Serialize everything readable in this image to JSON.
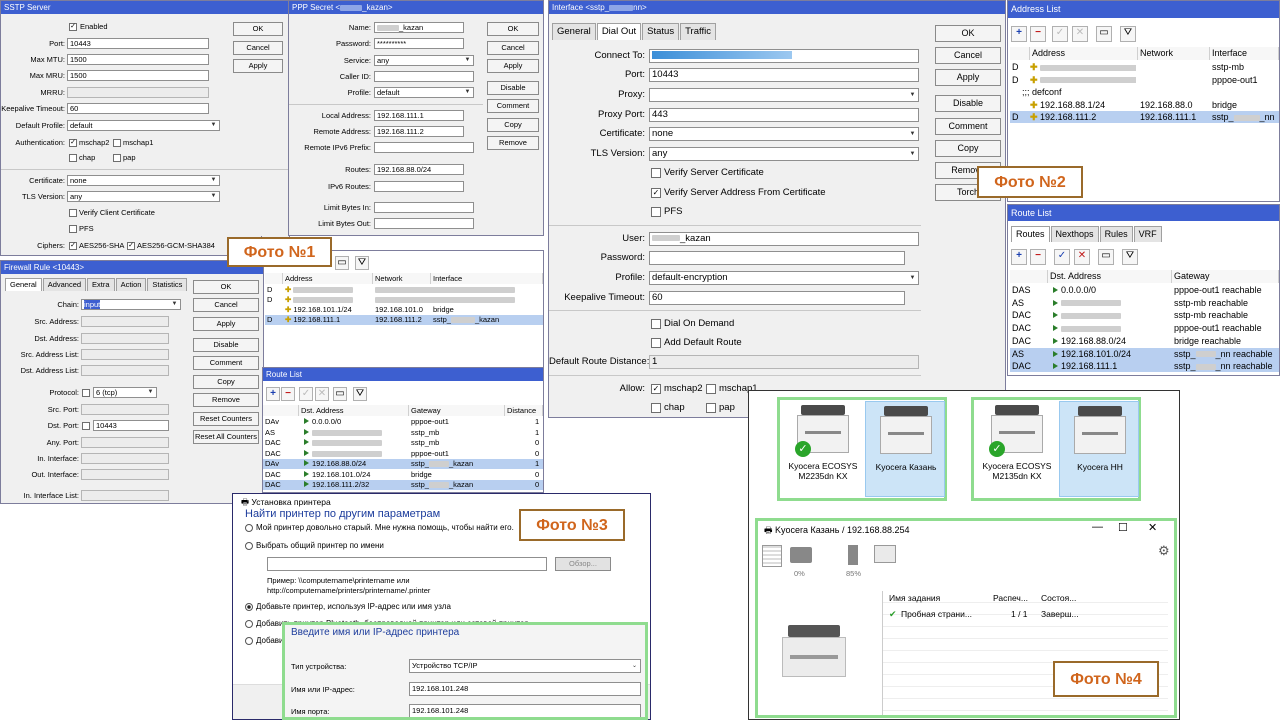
{
  "sstp": {
    "title": "SSTP Server",
    "enabled": "Enabled",
    "port_l": "Port:",
    "port": "10443",
    "mtu_l": "Max MTU:",
    "mtu": "1500",
    "mru_l": "Max MRU:",
    "mru": "1500",
    "mrru_l": "MRRU:",
    "ka_l": "Keepalive Timeout:",
    "ka": "60",
    "dp_l": "Default Profile:",
    "dp": "default",
    "auth_l": "Authentication:",
    "a1": "mschap2",
    "a2": "mschap1",
    "a3": "chap",
    "a4": "pap",
    "cert_l": "Certificate:",
    "cert": "none",
    "tls_l": "TLS Version:",
    "tls": "any",
    "vcc": "Verify Client Certificate",
    "pfs": "PFS",
    "ciph_l": "Ciphers:",
    "c1": "AES256-SHA",
    "c2": "AES256-GCM-SHA384",
    "ok": "OK",
    "cancel": "Cancel",
    "apply": "Apply"
  },
  "ppp": {
    "title": "PPP Secret <",
    "title_end": "_kazan>",
    "name_l": "Name:",
    "name": "_kazan",
    "pw_l": "Password:",
    "pw": "**********",
    "svc_l": "Service:",
    "svc": "any",
    "cid_l": "Caller ID:",
    "prof_l": "Profile:",
    "prof": "default",
    "la_l": "Local Address:",
    "la": "192.168.111.1",
    "ra_l": "Remote Address:",
    "ra": "192.168.111.2",
    "r6_l": "Remote IPv6 Prefix:",
    "rt_l": "Routes:",
    "rt": "192.168.88.0/24",
    "r6r_l": "IPv6 Routes:",
    "lbi_l": "Limit Bytes In:",
    "lbo_l": "Limit Bytes Out:",
    "ok": "OK",
    "cancel": "Cancel",
    "apply": "Apply",
    "disable": "Disable",
    "comment": "Comment",
    "copy": "Copy",
    "remove": "Remove"
  },
  "photo1": "Фото №1",
  "photo2": "Фото №2",
  "photo3": "Фото №3",
  "photo4": "Фото №4",
  "addr1": {
    "h": [
      "Address",
      "Network",
      "Interface"
    ],
    "rows": [
      {
        "f": "D",
        "a": "",
        "n": "",
        "i": ""
      },
      {
        "f": "D",
        "a": "",
        "n": "",
        "i": ""
      },
      {
        "f": "",
        "a": "192.168.101.1/24",
        "n": "192.168.101.0",
        "i": "bridge"
      },
      {
        "f": "D",
        "a": "192.168.111.1",
        "n": "192.168.111.2",
        "i": "sstp_",
        "i2": "_kazan"
      }
    ]
  },
  "fw": {
    "title": "Firewall Rule <10443>",
    "tabs": [
      "General",
      "Advanced",
      "Extra",
      "Action",
      "Statistics"
    ],
    "chain_l": "Chain:",
    "chain": "input",
    "sa_l": "Src. Address:",
    "da_l": "Dst. Address:",
    "sal_l": "Src. Address List:",
    "dal_l": "Dst. Address List:",
    "proto_l": "Protocol:",
    "proto": "6 (tcp)",
    "sp_l": "Src. Port:",
    "dp_l": "Dst. Port:",
    "dp": "10443",
    "ap_l": "Any. Port:",
    "ii_l": "In. Interface:",
    "oi_l": "Out. Interface:",
    "iil_l": "In. Interface List:",
    "b": [
      "OK",
      "Cancel",
      "Apply",
      "Disable",
      "Comment",
      "Copy",
      "Remove",
      "Reset Counters",
      "Reset All Counters"
    ]
  },
  "rl1": {
    "title": "Route List",
    "h": [
      "Dst. Address",
      "Gateway",
      "Distance"
    ],
    "rows": [
      {
        "f": "DAv",
        "d": "0.0.0.0/0",
        "g": "pppoe-out1",
        "x": "1"
      },
      {
        "f": "AS",
        "d": "",
        "g": "sstp_mb",
        "x": "1"
      },
      {
        "f": "DAC",
        "d": "",
        "g": "sstp_mb",
        "x": "0"
      },
      {
        "f": "DAC",
        "d": "",
        "g": "pppoe-out1",
        "x": "0"
      },
      {
        "f": "DAv",
        "d": "192.168.88.0/24",
        "g": "sstp_",
        "g2": "_kazan",
        "x": "1"
      },
      {
        "f": "DAC",
        "d": "192.168.101.0/24",
        "g": "bridge",
        "x": "0"
      },
      {
        "f": "DAC",
        "d": "192.168.111.2/32",
        "g": "sstp_",
        "g2": "_kazan",
        "x": "0"
      }
    ]
  },
  "iface": {
    "title": "Interface <sstp_",
    "title_end": "nn>",
    "tabs": [
      "General",
      "Dial Out",
      "Status",
      "Traffic"
    ],
    "ct_l": "Connect To:",
    "port_l": "Port:",
    "port": "10443",
    "proxy_l": "Proxy:",
    "pp_l": "Proxy Port:",
    "pp": "443",
    "cert_l": "Certificate:",
    "cert": "none",
    "tls_l": "TLS Version:",
    "tls": "any",
    "vsc": "Verify Server Certificate",
    "vsa": "Verify Server Address From Certificate",
    "pfs": "PFS",
    "user_l": "User:",
    "user": "_kazan",
    "pw_l": "Password:",
    "prof_l": "Profile:",
    "prof": "default-encryption",
    "ka_l": "Keepalive Timeout:",
    "ka": "60",
    "dod": "Dial On Demand",
    "adr": "Add Default Route",
    "drd_l": "Default Route Distance:",
    "drd": "1",
    "allow_l": "Allow:",
    "a1": "mschap2",
    "a2": "mschap1",
    "a3": "chap",
    "a4": "pap",
    "b": [
      "OK",
      "Cancel",
      "Apply",
      "Disable",
      "Comment",
      "Copy",
      "Remove",
      "Torch"
    ]
  },
  "addr2": {
    "title": "Address List",
    "h": [
      "Address",
      "Network",
      "Interface"
    ],
    "rows": [
      {
        "f": "D",
        "a": "",
        "n": "",
        "i": "sstp-mb"
      },
      {
        "f": "D",
        "a": "",
        "n": "",
        "i": "pppoe-out1"
      },
      {
        "f": "",
        "a": ";;; defconf",
        "n": "",
        "i": ""
      },
      {
        "f": "",
        "a": "192.168.88.1/24",
        "n": "192.168.88.0",
        "i": "bridge"
      },
      {
        "f": "D",
        "a": "192.168.111.2",
        "n": "192.168.111.1",
        "i": "sstp_",
        "i2": "_nn"
      }
    ]
  },
  "rl2": {
    "title": "Route List",
    "tabs": [
      "Routes",
      "Nexthops",
      "Rules",
      "VRF"
    ],
    "h": [
      "Dst. Address",
      "Gateway"
    ],
    "rows": [
      {
        "f": "DAS",
        "d": "0.0.0.0/0",
        "g": "pppoe-out1 reachable"
      },
      {
        "f": "AS",
        "d": "",
        "g": "sstp-mb reachable"
      },
      {
        "f": "DAC",
        "d": "",
        "g": "sstp-mb reachable"
      },
      {
        "f": "DAC",
        "d": "",
        "g": "pppoe-out1 reachable"
      },
      {
        "f": "DAC",
        "d": "192.168.88.0/24",
        "g": "bridge reachable"
      },
      {
        "f": "AS",
        "d": "192.168.101.0/24",
        "g": "sstp_",
        "g2": "_nn reachable"
      },
      {
        "f": "DAC",
        "d": "192.168.111.1",
        "g": "sstp_",
        "g2": "_nn reachable"
      }
    ]
  },
  "pr": {
    "title": "Установка принтера",
    "head": "Найти принтер по другим параметрам",
    "o1": "Мой принтер довольно старый. Мне нужна помощь, чтобы найти его.",
    "o2": "Выбрать общий принтер по имени",
    "browse": "Обзор...",
    "ex1": "Пример: \\\\computername\\printername или",
    "ex2": "http://computername/printers/printername/.printer",
    "o3": "Добавьте принтер, используя IP-адрес или имя узла",
    "o4": "Добавить принтер Bluetooth, беспроводной принтер или сетевой принтер",
    "o5": "Добавить"
  },
  "ipd": {
    "head": "Введите имя или IP-адрес принтера",
    "type_l": "Тип устройства:",
    "type": "Устройство TCP/IP",
    "host_l": "Имя или IP-адрес:",
    "host": "192.168.101.248",
    "port_l": "Имя порта:",
    "port": "192.168.101.248"
  },
  "prn1": [
    {
      "name": "Kyocera ECOSYS M2235dn KX"
    },
    {
      "name": "Kyocera Казань"
    }
  ],
  "prn2": [
    {
      "name": "Kyocera ECOSYS M2135dn KX"
    },
    {
      "name": "Kyocera HH"
    }
  ],
  "q": {
    "title": "Kyocera Казань / 192.168.88.254",
    "p1": "0%",
    "p2": "85%",
    "h": [
      "Имя задания",
      "Распеч...",
      "Состоя..."
    ],
    "job": "Пробная страни...",
    "pages": "1 / 1",
    "state": "Заверш..."
  }
}
